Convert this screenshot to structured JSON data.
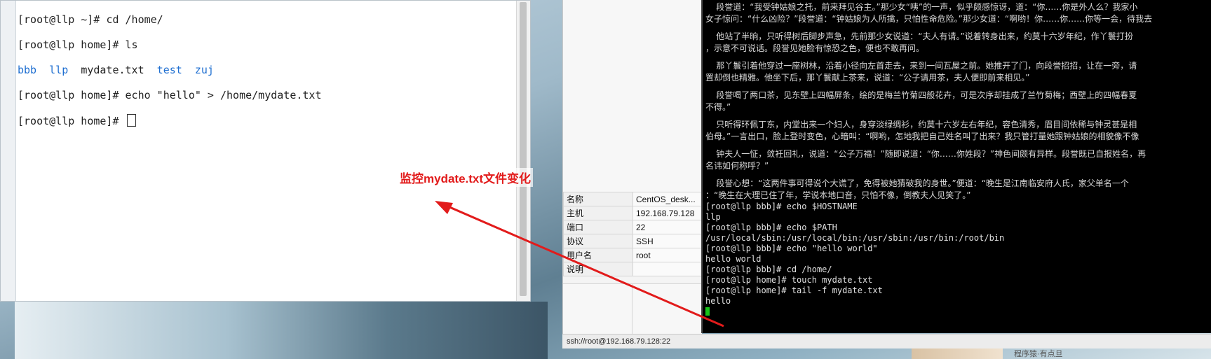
{
  "left_terminal": {
    "lines": [
      {
        "prompt": "[root@llp ~]# ",
        "cmd": "cd /home/"
      },
      {
        "prompt": "[root@llp home]# ",
        "cmd": "ls"
      },
      {
        "prompt": "[root@llp home]# ",
        "cmd": "echo \"hello\" > /home/mydate.txt"
      },
      {
        "prompt": "[root@llp home]# ",
        "cmd": ""
      }
    ],
    "ls_output": [
      "bbb",
      "llp",
      "mydate.txt",
      "test",
      "zuj"
    ]
  },
  "session_info": {
    "rows": [
      {
        "key": "名称",
        "value": "CentOS_desk..."
      },
      {
        "key": "主机",
        "value": "192.168.79.128"
      },
      {
        "key": "端口",
        "value": "22"
      },
      {
        "key": "协议",
        "value": "SSH"
      },
      {
        "key": "用户名",
        "value": "root"
      },
      {
        "key": "说明",
        "value": ""
      }
    ],
    "status": "ssh://root@192.168.79.128:22"
  },
  "ssh_terminal": {
    "story_lines": [
      "    段誉道：“我受钟姑娘之托，前来拜见谷主。”那少女“咦”的一声，似乎颇感惊讶，道：“你……你是外人么？我家小",
      "女子惊问：“什么凶险？”段誉道：“钟姑娘为人所擒，只怕性命危险。”那少女道：“啊哟！你……你……你等一会，待我去",
      "",
      "    他站了半晌，只听得树后脚步声急，先前那少女说道：“夫人有请。”说着转身出来，约莫十六岁年纪，作丫鬟打扮",
      "，示意不可说话。段誉见她脸有惊恐之色，便也不敢再问。",
      "",
      "    那丫鬟引着他穿过一座树林，沿着小径向左首走去，来到一间瓦屋之前。她推开了门，向段誉招招，让在一旁，请",
      "置却倒也精雅。他坐下后，那丫鬟献上茶来，说道：“公子请用茶，夫人便即前来相见。”",
      "",
      "    段誉喝了两口茶，见东壁上四幅屏条，绘的是梅兰竹菊四般花卉，可是次序却挂成了兰竹菊梅；西壁上的四幅春夏",
      "不得。”",
      "",
      "    只听得环佩丁东，内堂出来一个妇人，身穿淡绿绸衫，约莫十六岁左右年纪，容色清秀，眉目间依稀与钟灵甚是相",
      "伯母。”一言出口，脸上登时变色，心暗叫：“啊哟，怎地我把自己姓名叫了出来？我只管打量她跟钟姑娘的相貌像不像",
      "",
      "    钟夫人一怔，敛衽回礼，说道：“公子万福！”随即说道：“你……你姓段？”神色间颇有异样。段誉既已自报姓名，再",
      "名讳如何称呼？”",
      "",
      "    段誉心想：“这两件事可得说个大谎了，免得被她猜破我的身世。”便道：“晚生是江南临安府人氏，家父单名一个",
      "：“晚生在大理已住了年，学说本地口音，只怕不像，倒教夫人见笑了。”"
    ],
    "shell_lines": [
      "[root@llp bbb]# echo $HOSTNAME",
      "llp",
      "[root@llp bbb]# echo $PATH",
      "/usr/local/sbin:/usr/local/bin:/usr/sbin:/usr/bin:/root/bin",
      "[root@llp bbb]# echo \"hello world\"",
      "hello world",
      "[root@llp bbb]# cd /home/",
      "[root@llp home]# touch mydate.txt",
      "[root@llp home]# tail -f mydate.txt",
      "hello"
    ]
  },
  "annotation": {
    "text": "监控mydate.txt文件变化",
    "color": "#e21b1b"
  },
  "taskbar": {
    "text": "程序猿·有点旦"
  },
  "colors": {
    "ls_dir_blue": "#1f6fd1",
    "ssh_cursor_green": "#18c41a",
    "ssh_bg": "#000000"
  }
}
